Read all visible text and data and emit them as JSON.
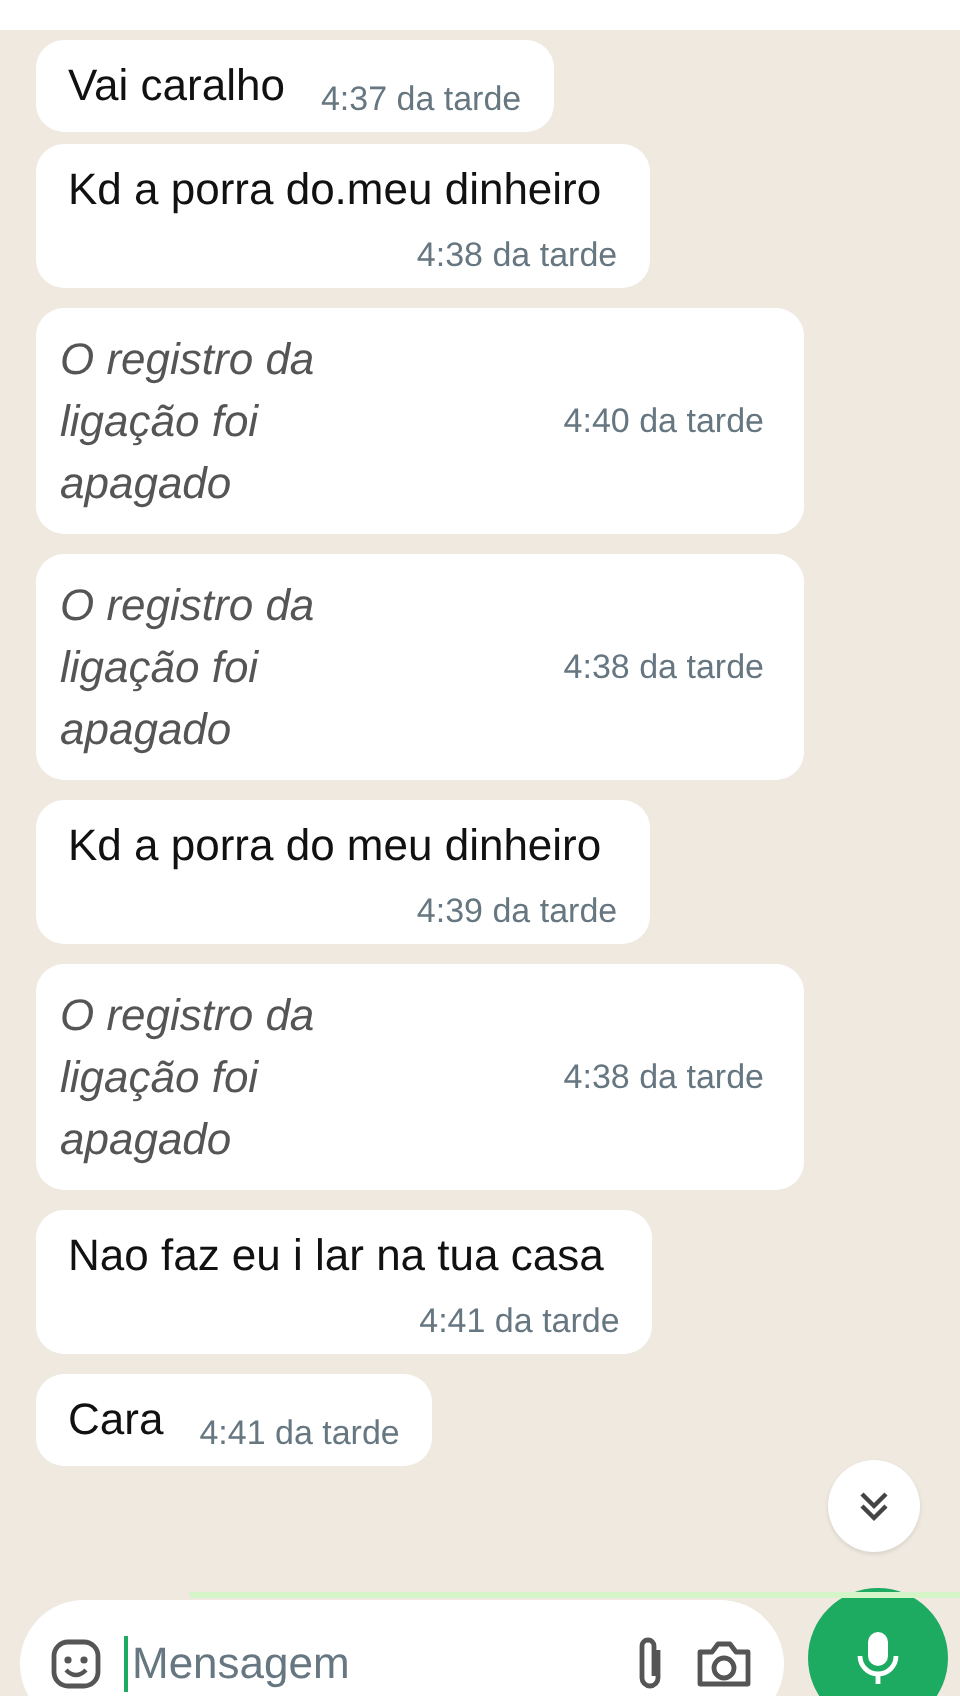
{
  "messages": [
    {
      "kind": "short",
      "text": "Vai caralho",
      "time": "4:37 da tarde"
    },
    {
      "kind": "long",
      "text": "Kd a porra do.meu dinheiro",
      "time": "4:38 da tarde"
    },
    {
      "kind": "deleted",
      "text": "O registro da ligação foi apagado",
      "time": "4:40 da tarde"
    },
    {
      "kind": "deleted",
      "text": "O registro da ligação foi apagado",
      "time": "4:38 da tarde"
    },
    {
      "kind": "long",
      "text": "Kd a porra do meu dinheiro",
      "time": "4:39 da tarde"
    },
    {
      "kind": "deleted",
      "text": "O registro da ligação foi apagado",
      "time": "4:38 da tarde"
    },
    {
      "kind": "long",
      "text": "Nao faz eu i lar na tua casa",
      "time": "4:41 da tarde"
    },
    {
      "kind": "short",
      "text": "Cara",
      "time": "4:41 da tarde"
    }
  ],
  "composer": {
    "placeholder": "Mensagem"
  }
}
